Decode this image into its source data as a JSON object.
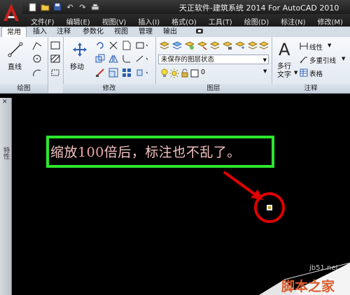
{
  "title_bar": {
    "title": "天正软件-建筑系统 2014  For AutoCAD 2010",
    "quick_access": [
      "new-file-icon",
      "open-file-icon",
      "save-icon",
      "undo-icon",
      "redo-icon",
      "print-icon"
    ]
  },
  "menu": [
    "文件(F)",
    "编辑(E)",
    "视图(V)",
    "插入(I)",
    "格式(O)",
    "工具(T)",
    "绘图(D)",
    "标注(N)",
    "修改(M)"
  ],
  "ribbon_tabs": [
    "常用",
    "插入",
    "注释",
    "参数化",
    "视图",
    "管理",
    "输出"
  ],
  "ribbon": {
    "draw": {
      "line_label": "直线",
      "title": "绘图"
    },
    "modify": {
      "move_label": "移动",
      "title": "修改"
    },
    "layers": {
      "layer_state": "未保存的图层状态",
      "layer_current": "0",
      "title": "图层"
    },
    "annotation": {
      "multiline_text_label_1": "多行",
      "multiline_text_label_2": "文字",
      "linear_label": "线性",
      "multileader_label": "多重引线",
      "table_label": "表格",
      "title": "注释"
    }
  },
  "side_panel": {
    "label": "特性"
  },
  "canvas": {
    "annotation_text_before": "缩放",
    "annotation_text_number": "100",
    "annotation_text_after": "倍后，标注也不乱了。"
  },
  "watermark": {
    "url": "jb51.net",
    "name": "脚本之家"
  },
  "colors": {
    "highlight_box": "#2ee62e",
    "callout": "#e00000",
    "annotation_text": "#f4c2c2"
  }
}
